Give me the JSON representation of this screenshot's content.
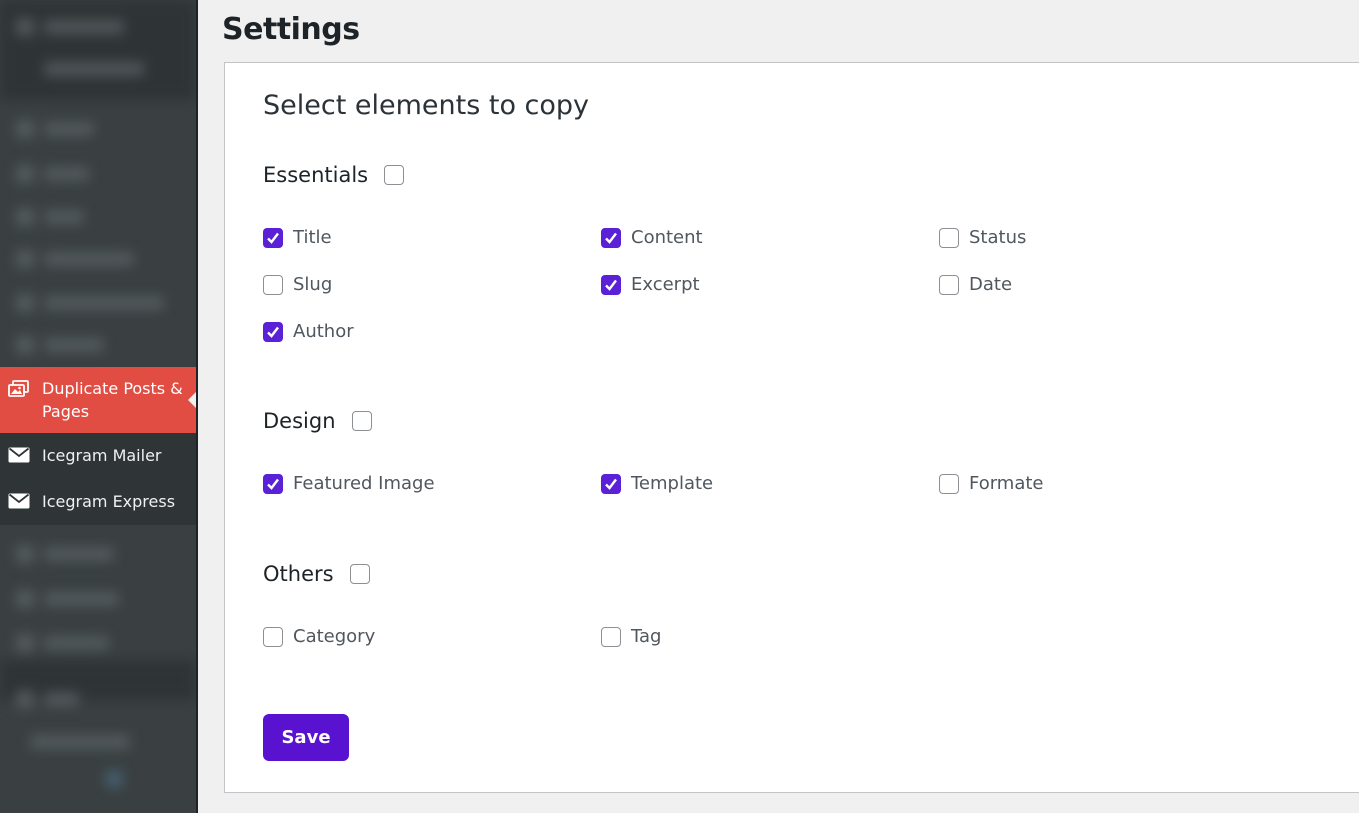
{
  "sidebar": {
    "active_item": {
      "label": "Duplicate Posts & Pages",
      "icon": "images-icon"
    },
    "items": [
      {
        "label": "Icegram Mailer",
        "icon": "envelope-icon"
      },
      {
        "label": "Icegram Express",
        "icon": "envelope-icon"
      }
    ],
    "colors": {
      "background": "#3a4042",
      "active": "#e14d43",
      "item": "#2f3437"
    }
  },
  "page": {
    "title": "Settings"
  },
  "panel": {
    "heading": "Select elements to copy",
    "sections": {
      "essentials": {
        "label": "Essentials",
        "checked": false,
        "options": [
          {
            "label": "Title",
            "checked": true
          },
          {
            "label": "Content",
            "checked": true
          },
          {
            "label": "Status",
            "checked": false
          },
          {
            "label": "Slug",
            "checked": false
          },
          {
            "label": "Excerpt",
            "checked": true
          },
          {
            "label": "Date",
            "checked": false
          },
          {
            "label": "Author",
            "checked": true
          }
        ]
      },
      "design": {
        "label": "Design",
        "checked": false,
        "options": [
          {
            "label": "Featured Image",
            "checked": true
          },
          {
            "label": "Template",
            "checked": true
          },
          {
            "label": "Formate",
            "checked": false
          }
        ]
      },
      "others": {
        "label": "Others",
        "checked": false,
        "options": [
          {
            "label": "Category",
            "checked": false
          },
          {
            "label": "Tag",
            "checked": false
          }
        ]
      }
    },
    "save_label": "Save",
    "accent_color": "#5b21d6"
  }
}
